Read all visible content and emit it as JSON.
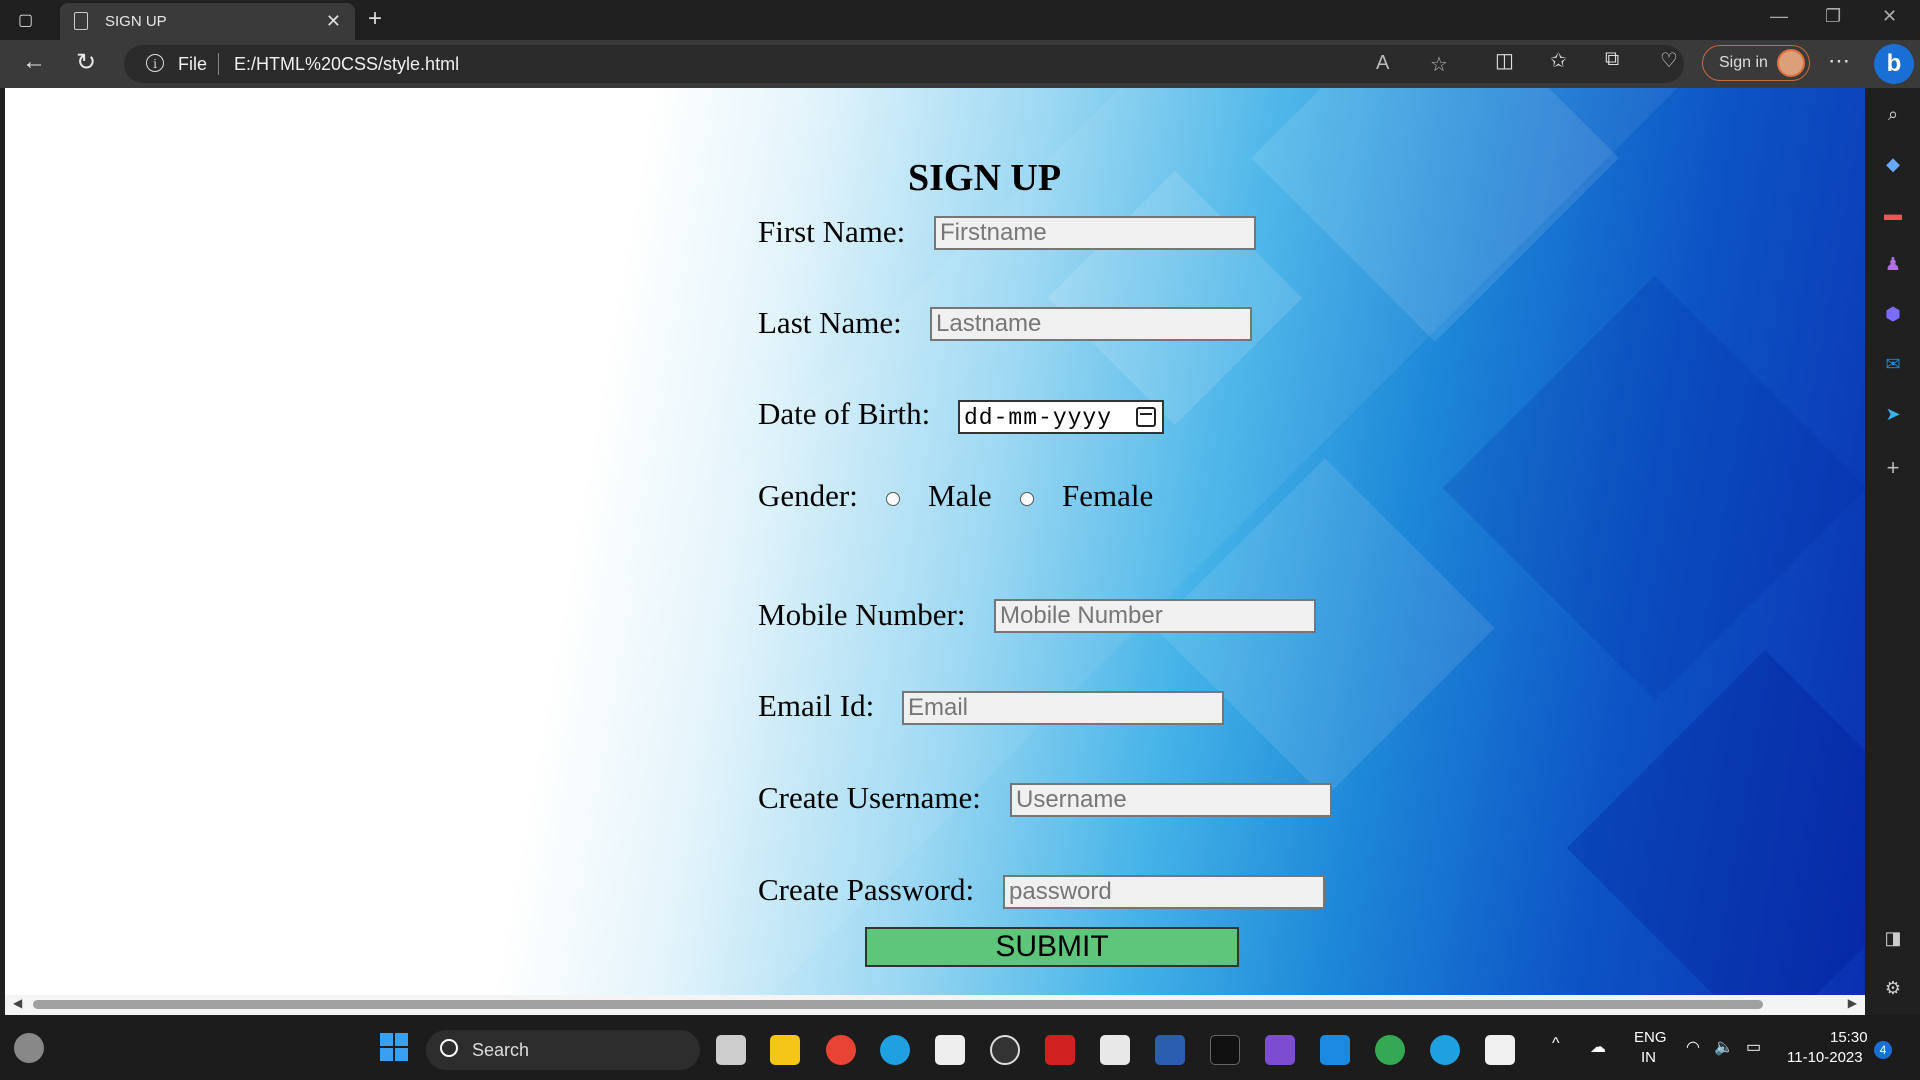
{
  "browser": {
    "tab_title": "SIGN UP",
    "address_scheme_label": "File",
    "url": "E:/HTML%20CSS/style.html",
    "signin_label": "Sign in"
  },
  "form": {
    "title": "SIGN UP",
    "first_name_label": "First Name:",
    "first_name_placeholder": "Firstname",
    "last_name_label": "Last Name:",
    "last_name_placeholder": "Lastname",
    "dob_label": "Date of Birth:",
    "dob_placeholder": "dd-mm-yyyy",
    "gender_label": "Gender:",
    "gender_male": "Male",
    "gender_female": "Female",
    "mobile_label": "Mobile Number:",
    "mobile_placeholder": "Mobile Number",
    "email_label": "Email Id:",
    "email_placeholder": "Email",
    "username_label": "Create Username:",
    "username_placeholder": "Username",
    "password_label": "Create Password:",
    "password_placeholder": "password",
    "submit_label": "SUBMIT"
  },
  "taskbar": {
    "search_label": "Search",
    "lang_line1": "ENG",
    "lang_line2": "IN",
    "time": "15:30",
    "date": "11-10-2023",
    "notification_count": "4"
  },
  "colors": {
    "submit_bg": "#5ec67a",
    "bing_blue": "#1a6fd6"
  }
}
